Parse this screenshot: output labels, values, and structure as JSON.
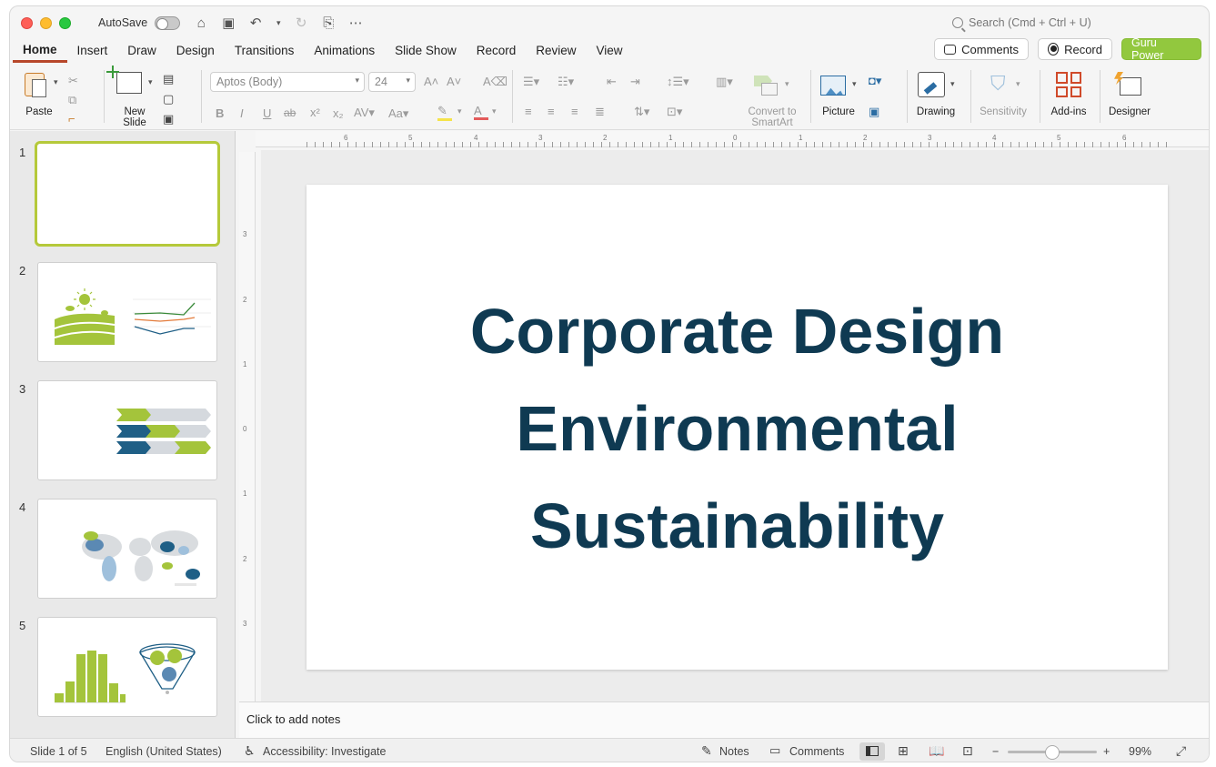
{
  "window": {
    "autosave_label": "AutoSave",
    "search_placeholder": "Search (Cmd + Ctrl + U)"
  },
  "tabs": [
    "Home",
    "Insert",
    "Draw",
    "Design",
    "Transitions",
    "Animations",
    "Slide Show",
    "Record",
    "Review",
    "View"
  ],
  "header_buttons": {
    "comments": "Comments",
    "record": "Record",
    "guru": "Guru Power"
  },
  "ribbon": {
    "paste": "Paste",
    "new_slide_1": "New",
    "new_slide_2": "Slide",
    "font_name": "Aptos (Body)",
    "font_size": "24",
    "convert_1": "Convert to",
    "convert_2": "SmartArt",
    "picture": "Picture",
    "drawing": "Drawing",
    "sensitivity": "Sensitivity",
    "addins": "Add-ins",
    "designer": "Designer",
    "bold": "B",
    "italic": "I",
    "underline": "U",
    "strike": "ab"
  },
  "slides": [
    {
      "num": "1"
    },
    {
      "num": "2"
    },
    {
      "num": "3"
    },
    {
      "num": "4"
    },
    {
      "num": "5"
    }
  ],
  "ruler_top": [
    "6",
    "5",
    "4",
    "3",
    "2",
    "1",
    "0",
    "1",
    "2",
    "3",
    "4",
    "5",
    "6"
  ],
  "ruler_left": [
    "3",
    "2",
    "1",
    "0",
    "1",
    "2",
    "3"
  ],
  "slide": {
    "line1": "Corporate Design",
    "line2": "Environmental",
    "line3": "Sustainability"
  },
  "notes_placeholder": "Click to add notes",
  "status": {
    "slide_count": "Slide 1 of 5",
    "language": "English (United States)",
    "accessibility": "Accessibility: Investigate",
    "notes": "Notes",
    "comments": "Comments",
    "zoom": "99%",
    "zoom_minus": "−",
    "zoom_plus": "+"
  },
  "colors": {
    "accent_green": "#92c83e",
    "title_navy": "#0f3a52",
    "tab_underline": "#b7472a"
  }
}
